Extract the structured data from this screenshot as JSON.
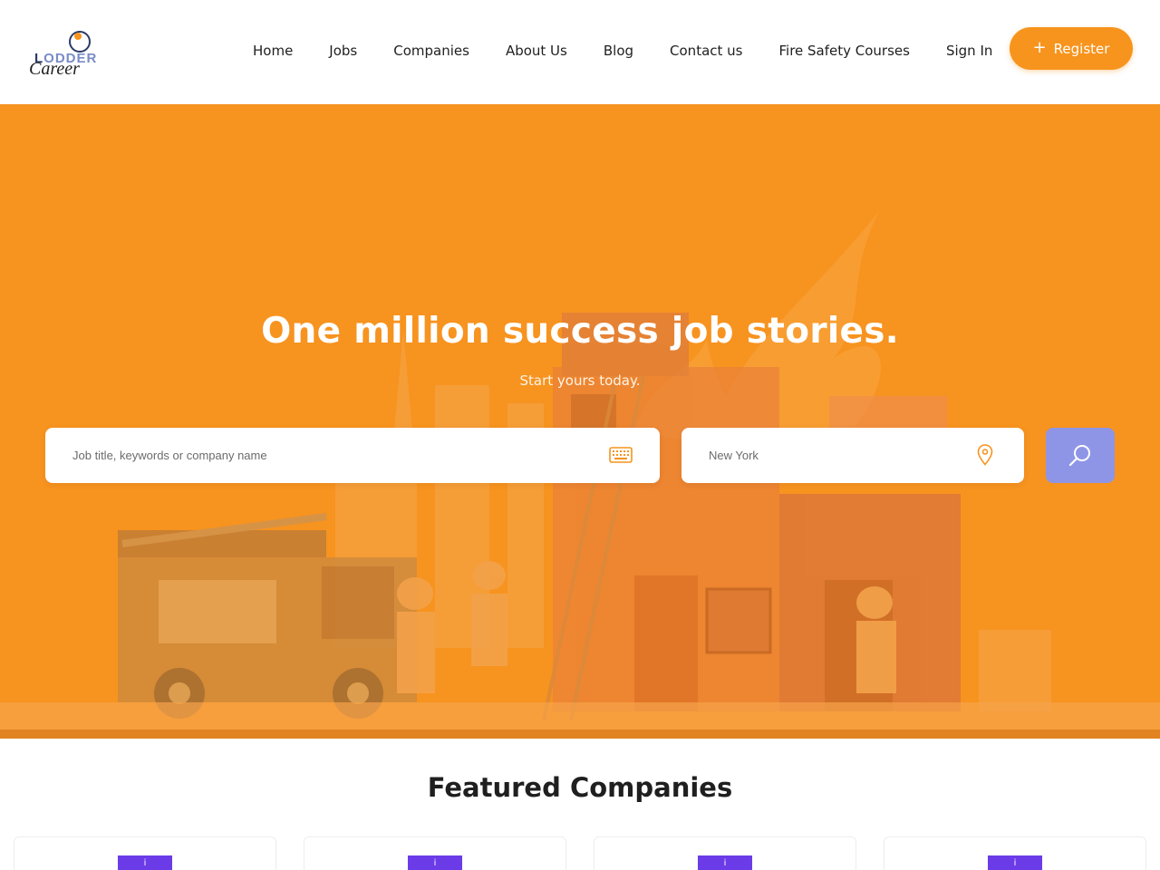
{
  "logo": {
    "word_top_a": "L",
    "word_top_b": "ODDER",
    "word_bottom": "Career",
    "icon": "person-logo-icon"
  },
  "nav": {
    "items": [
      {
        "label": "Home"
      },
      {
        "label": "Jobs"
      },
      {
        "label": "Companies"
      },
      {
        "label": "About Us"
      },
      {
        "label": "Blog"
      },
      {
        "label": "Contact us"
      },
      {
        "label": "Fire Safety Courses"
      },
      {
        "label": "Sign In"
      }
    ],
    "register_label": "Register",
    "register_icon": "plus-icon"
  },
  "hero": {
    "title": "One million success job stories.",
    "subtitle": "Start yours today.",
    "keyword_placeholder": "Job title, keywords or company name",
    "keyword_icon": "keyboard-icon",
    "location_placeholder": "New York",
    "location_icon": "map-pin-icon",
    "search_icon": "search-icon"
  },
  "featured": {
    "title": "Featured Companies",
    "cards": [
      {
        "logo_mark": "i"
      },
      {
        "logo_mark": "i"
      },
      {
        "logo_mark": "i"
      },
      {
        "logo_mark": "i"
      }
    ]
  },
  "colors": {
    "brand_orange": "#f7941d",
    "search_button": "#8f95e6",
    "company_logo": "#6b3be8"
  }
}
